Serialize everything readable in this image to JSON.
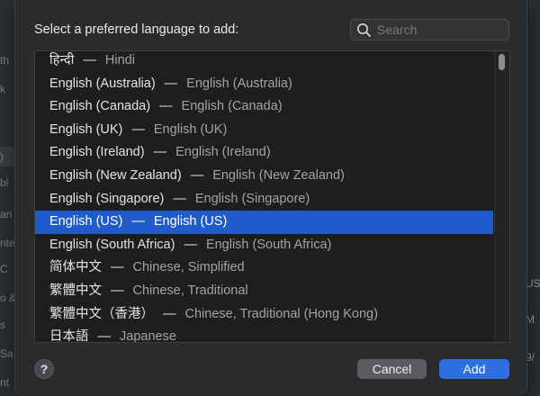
{
  "dialog": {
    "prompt": "Select a preferred language to add:",
    "search": {
      "placeholder": "Search",
      "value": ""
    },
    "languages": [
      {
        "native": "हिन्दी",
        "separator": "—",
        "translation": "Hindi"
      },
      {
        "native": "English (Australia)",
        "separator": "—",
        "translation": "English (Australia)"
      },
      {
        "native": "English (Canada)",
        "separator": "—",
        "translation": "English (Canada)"
      },
      {
        "native": "English (UK)",
        "separator": "—",
        "translation": "English (UK)"
      },
      {
        "native": "English (Ireland)",
        "separator": "—",
        "translation": "English (Ireland)"
      },
      {
        "native": "English (New Zealand)",
        "separator": "—",
        "translation": "English (New Zealand)"
      },
      {
        "native": "English (Singapore)",
        "separator": "—",
        "translation": "English (Singapore)"
      },
      {
        "native": "English (US)",
        "separator": "—",
        "translation": "English (US)",
        "selected": true
      },
      {
        "native": "English (South Africa)",
        "separator": "—",
        "translation": "English (South Africa)"
      },
      {
        "native": "简体中文",
        "separator": "—",
        "translation": "Chinese, Simplified"
      },
      {
        "native": "繁體中文",
        "separator": "—",
        "translation": "Chinese, Traditional"
      },
      {
        "native": "繁體中文（香港）",
        "separator": "—",
        "translation": "Chinese, Traditional (Hong Kong)"
      },
      {
        "native": "日本語",
        "separator": "—",
        "translation": "Japanese"
      }
    ],
    "help_label": "?",
    "cancel_label": "Cancel",
    "add_label": "Add"
  },
  "background": {
    "left_fragments": [
      "th",
      "k",
      ")",
      "bl",
      "an",
      "nte",
      "C",
      "o &",
      "s",
      "Sa",
      "nt"
    ],
    "right_fragments": [
      "US",
      "M",
      "9/"
    ]
  },
  "colors": {
    "selection": "#1f5bc9",
    "add_button": "#2f6fe0",
    "cancel_button": "#5b5c5f",
    "sheet_background": "#2a2b2d",
    "list_background": "#1e1e1e"
  },
  "icons": {
    "search": "magnifying-glass-icon",
    "help": "question-mark-icon"
  }
}
